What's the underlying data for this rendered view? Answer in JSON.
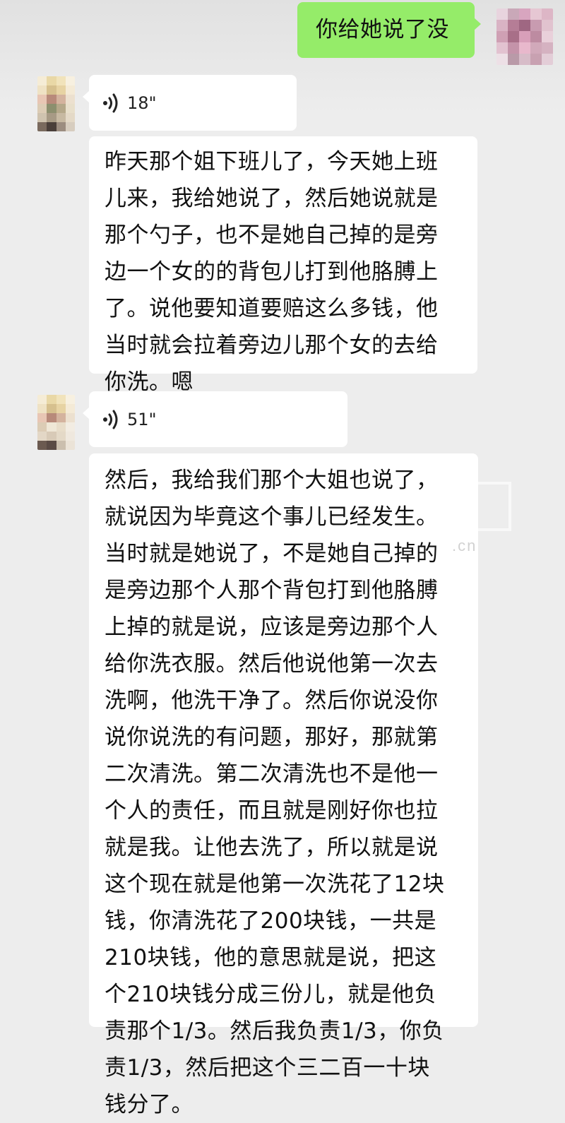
{
  "messages": [
    {
      "type": "text",
      "direction": "sent",
      "text": "你给她说了没"
    },
    {
      "type": "voice",
      "direction": "received",
      "duration": "18\""
    },
    {
      "type": "text",
      "direction": "received",
      "text": "昨天那个姐下班儿了，今天她上班\n儿来，我给她说了，然后她说就是\n那个勺子，也不是她自己掉的是旁\n边一个女的的背包儿打到他胳膊上\n了。说他要知道要赔这么多钱，他\n当时就会拉着旁边儿那个女的去给\n你洗。嗯"
    },
    {
      "type": "voice",
      "direction": "received",
      "duration": "51\""
    },
    {
      "type": "text",
      "direction": "received",
      "text": "然后，我给我们那个大姐也说了，\n就说因为毕竟这个事儿已经发生。\n当时就是她说了，不是她自己掉的\n是旁边那个人那个背包打到他胳膊\n上掉的就是说，应该是旁边那个人\n给你洗衣服。然后他说他第一次去\n洗啊，他洗干净了。然后你说没你\n说你说洗的有问题，那好，那就第\n二次清洗。第二次清洗也不是他一\n个人的责任，而且就是刚好你也拉\n就是我。让他去洗了，所以就是说\n这个现在就是他第一次洗花了12块\n钱，你清洗花了200块钱，一共是\n210块钱，他的意思就是说，把这\n个210块钱分成三份儿，就是他负\n责那个1/3。然后我负责1/3，你负\n责1/3，然后把这个三二百一十块\n钱分了。"
    }
  ],
  "watermark": {
    "suffix": ".cn"
  },
  "colors": {
    "background": "#ededed",
    "sent_bubble": "#95ec69",
    "received_bubble": "#ffffff"
  },
  "icons": {
    "voice": "voice-wave-icon"
  }
}
